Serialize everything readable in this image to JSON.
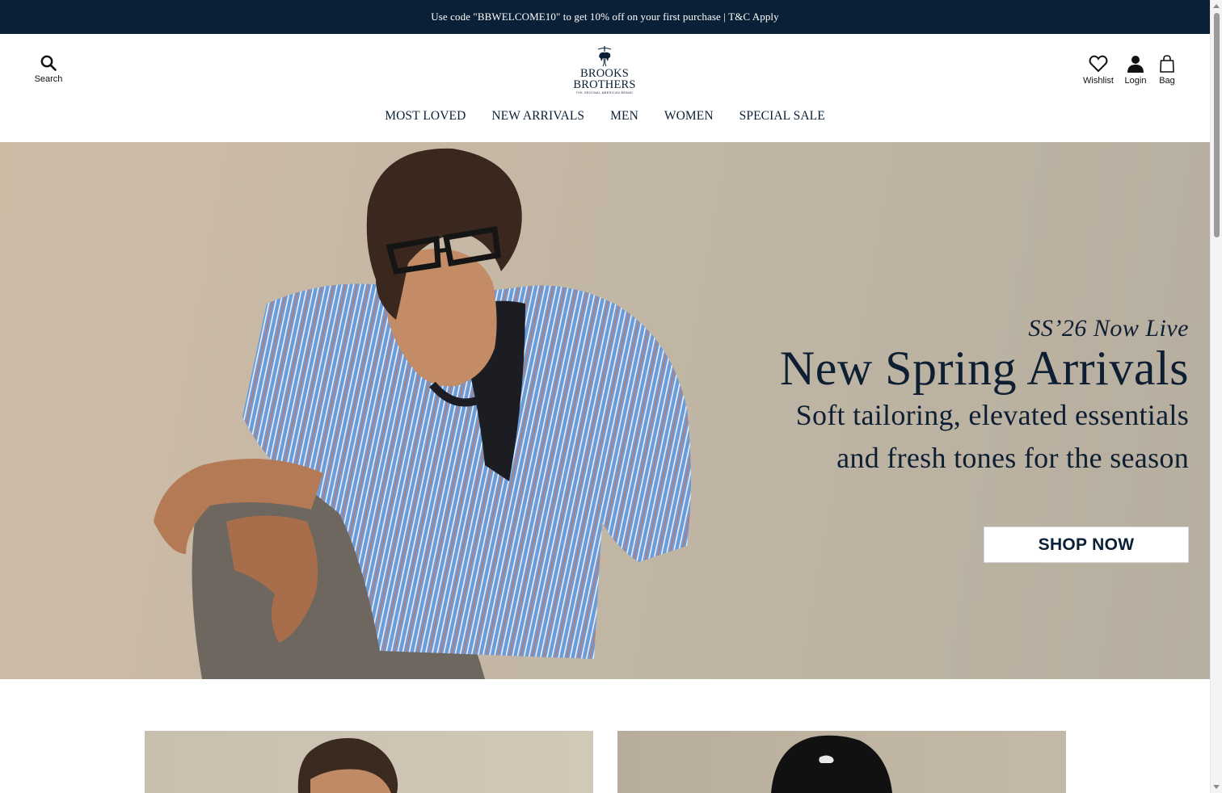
{
  "promo": {
    "text": "Use code \"BBWELCOME10\" to get 10% off on your first purchase | T&C Apply"
  },
  "header": {
    "search_label": "Search",
    "logo": {
      "line1": "BROOKS",
      "line2": "BROTHERS",
      "tagline": "THE ORIGINAL AMERICAN BRAND"
    },
    "wishlist_label": "Wishlist",
    "login_label": "Login",
    "bag_label": "Bag"
  },
  "nav": {
    "items": [
      {
        "label": "MOST LOVED"
      },
      {
        "label": "NEW ARRIVALS"
      },
      {
        "label": "MEN"
      },
      {
        "label": "WOMEN"
      },
      {
        "label": "SPECIAL SALE"
      }
    ]
  },
  "hero": {
    "kicker": "SS’26 Now Live",
    "title": "New Spring Arrivals",
    "subtitle_line1": "Soft tailoring, elevated essentials",
    "subtitle_line2": "and fresh tones for the season",
    "cta_label": "SHOP NOW",
    "colors": {
      "shirt": "#6a9ad6",
      "background": "#c4b8a6",
      "text": "#0f1f33"
    }
  },
  "icons": {
    "search": "search-icon",
    "wishlist": "heart-icon",
    "login": "user-icon",
    "bag": "shopping-bag-icon",
    "logo": "golden-fleece-logo-icon"
  },
  "colors": {
    "brand_navy": "#0a2036",
    "promo_bg": "#0a2036",
    "cta_bg": "#ffffff"
  }
}
